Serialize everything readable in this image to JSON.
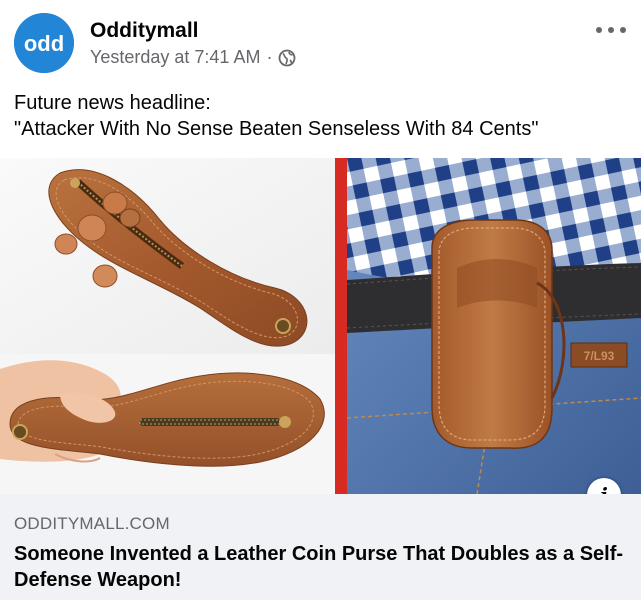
{
  "post": {
    "author": "Odditymall",
    "avatar_text": "odd",
    "timestamp": "Yesterday at 7:41 AM",
    "separator": "·",
    "privacy_icon": "globe-icon",
    "more_icon": "more-horizontal-icon",
    "caption_line1": "Future news headline:",
    "caption_line2": "\"Attacker With No Sense Beaten Senseless With 84 Cents\""
  },
  "images": {
    "info_label": "i",
    "belt_tag": "7/L93"
  },
  "link_preview": {
    "domain": "ODDITYMALL.COM",
    "title": "Someone Invented a Leather Coin Purse That Doubles as a Self-Defense Weapon!"
  },
  "colors": {
    "avatar_blue": "#1f7fd1",
    "accent_red": "#d62a22",
    "leather": "#a9643a",
    "meta_gray": "#65676b",
    "link_bg": "#f0f2f5"
  }
}
